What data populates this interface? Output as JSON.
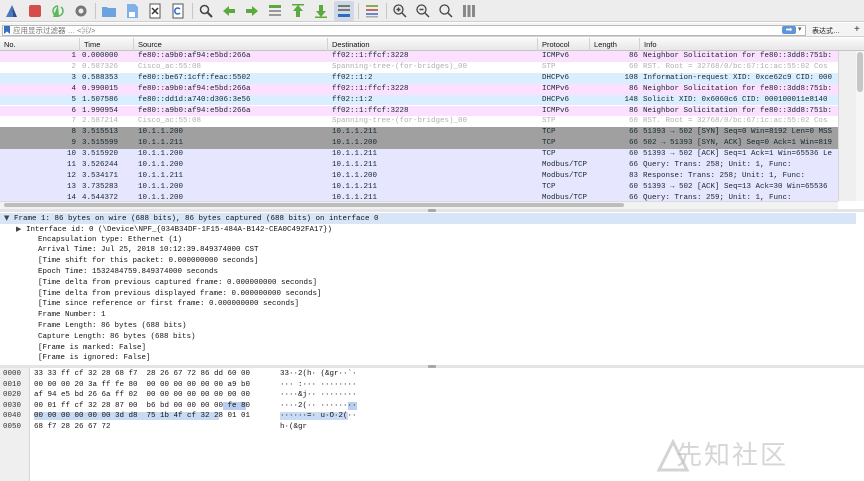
{
  "filter": {
    "placeholder": "应用显示过滤器 … <⌘/>",
    "apply_glyph": "➡",
    "dropdown_glyph": "▾",
    "expression_label": "表达式…",
    "add_glyph": "+"
  },
  "toolbar": {
    "icons": [
      "shark-fin-icon",
      "stop-icon",
      "restart-icon",
      "options-gear-icon",
      "open-folder-icon",
      "save-file-icon",
      "close-file-icon",
      "reload-icon",
      "find-icon",
      "back-arrow-icon",
      "forward-arrow-icon",
      "goto-packet-icon",
      "first-packet-icon",
      "last-packet-icon",
      "autoscroll-icon",
      "colorize-icon",
      "zoom-in-icon",
      "zoom-out-icon",
      "normal-size-icon",
      "resize-columns-icon"
    ]
  },
  "packet_list": {
    "columns": [
      "No.",
      "Time",
      "Source",
      "Destination",
      "Protocol",
      "Length",
      "Info"
    ],
    "rows": [
      {
        "no": "1",
        "time": "0.000000",
        "src": "fe80::a9b0:af94:e5bd:266a",
        "dst": "ff02::1:ffcf:3228",
        "proto": "ICMPv6",
        "len": "86",
        "info": "Neighbor Solicitation for fe80::3dd8:751b:",
        "bg": "#fce0ff",
        "fg": "#12272e"
      },
      {
        "no": "2",
        "time": "0.587326",
        "src": "Cisco_ac:55:08",
        "dst": "Spanning-tree-(for-bridges)_00",
        "proto": "STP",
        "len": "60",
        "info": "RST. Root = 32768/0/bc:67:1c:ac:55:02  Cos",
        "bg": "#ffffff",
        "fg": "#b0b0b0"
      },
      {
        "no": "3",
        "time": "0.588353",
        "src": "fe80::be67:1cff:feac:5502",
        "dst": "ff02::1:2",
        "proto": "DHCPv6",
        "len": "108",
        "info": "Information-request XID: 0xce62c9 CID: 000",
        "bg": "#daeeff",
        "fg": "#12272e"
      },
      {
        "no": "4",
        "time": "0.990015",
        "src": "fe80::a9b0:af94:e5bd:266a",
        "dst": "ff02::1:ffcf:3228",
        "proto": "ICMPv6",
        "len": "86",
        "info": "Neighbor Solicitation for fe80::3dd8:751b:",
        "bg": "#fce0ff",
        "fg": "#12272e"
      },
      {
        "no": "5",
        "time": "1.507586",
        "src": "fe80::dd1d:a740:d306:3e56",
        "dst": "ff02::1:2",
        "proto": "DHCPv6",
        "len": "148",
        "info": "Solicit XID: 0x6060c6 CID: 000100011e8140",
        "bg": "#daeeff",
        "fg": "#12272e"
      },
      {
        "no": "6",
        "time": "1.990954",
        "src": "fe80::a9b0:af94:e5bd:266a",
        "dst": "ff02::1:ffcf:3228",
        "proto": "ICMPv6",
        "len": "86",
        "info": "Neighbor Solicitation for fe80::3dd8:751b:",
        "bg": "#fce0ff",
        "fg": "#12272e"
      },
      {
        "no": "7",
        "time": "2.587214",
        "src": "Cisco_ac:55:08",
        "dst": "Spanning-tree-(for-bridges)_00",
        "proto": "STP",
        "len": "60",
        "info": "RST. Root = 32768/0/bc:67:1c:ac:55:02  Cos",
        "bg": "#ffffff",
        "fg": "#b0b0b0"
      },
      {
        "no": "8",
        "time": "3.515513",
        "src": "10.1.1.200",
        "dst": "10.1.1.211",
        "proto": "TCP",
        "len": "66",
        "info": "51393 → 502 [SYN] Seq=0 Win=8192 Len=0 MSS",
        "bg": "#a0a0a0",
        "fg": "#12272e"
      },
      {
        "no": "9",
        "time": "3.515599",
        "src": "10.1.1.211",
        "dst": "10.1.1.200",
        "proto": "TCP",
        "len": "66",
        "info": "502 → 51393 [SYN, ACK] Seq=0 Ack=1 Win=819",
        "bg": "#a0a0a0",
        "fg": "#12272e"
      },
      {
        "no": "10",
        "time": "3.515920",
        "src": "10.1.1.200",
        "dst": "10.1.1.211",
        "proto": "TCP",
        "len": "60",
        "info": "51393 → 502 [ACK] Seq=1 Ack=1 Win=65536 Le",
        "bg": "#e7e6ff",
        "fg": "#12272e"
      },
      {
        "no": "11",
        "time": "3.526244",
        "src": "10.1.1.200",
        "dst": "10.1.1.211",
        "proto": "Modbus/TCP",
        "len": "66",
        "info": "   Query: Trans:   258; Unit:   1, Func:",
        "bg": "#e7e6ff",
        "fg": "#12272e"
      },
      {
        "no": "12",
        "time": "3.534171",
        "src": "10.1.1.211",
        "dst": "10.1.1.200",
        "proto": "Modbus/TCP",
        "len": "83",
        "info": "Response: Trans:   258; Unit:   1, Func:",
        "bg": "#e7e6ff",
        "fg": "#12272e"
      },
      {
        "no": "13",
        "time": "3.735283",
        "src": "10.1.1.200",
        "dst": "10.1.1.211",
        "proto": "TCP",
        "len": "60",
        "info": "51393 → 502 [ACK] Seq=13 Ack=30 Win=65536",
        "bg": "#e7e6ff",
        "fg": "#12272e"
      },
      {
        "no": "14",
        "time": "4.544372",
        "src": "10.1.1.200",
        "dst": "10.1.1.211",
        "proto": "Modbus/TCP",
        "len": "66",
        "info": "   Query: Trans:   259; Unit:   1, Func:",
        "bg": "#e7e6ff",
        "fg": "#12272e"
      }
    ]
  },
  "details": {
    "lines": [
      {
        "arrow": "▼",
        "indent": 0,
        "text": "Frame 1: 86 bytes on wire (688 bits), 86 bytes captured (688 bits) on interface 0",
        "selected": true
      },
      {
        "arrow": "▶",
        "indent": 1,
        "text": "Interface id: 0 (\\Device\\NPF_{034B34DF-1F15-484A-B142-CEA0C492FA17})",
        "selected": false
      },
      {
        "arrow": "",
        "indent": 2,
        "text": "Encapsulation type: Ethernet (1)",
        "selected": false
      },
      {
        "arrow": "",
        "indent": 2,
        "text": "Arrival Time: Jul 25, 2018 10:12:39.849374000 CST",
        "selected": false
      },
      {
        "arrow": "",
        "indent": 2,
        "text": "[Time shift for this packet: 0.000000000 seconds]",
        "selected": false
      },
      {
        "arrow": "",
        "indent": 2,
        "text": "Epoch Time: 1532484759.849374000 seconds",
        "selected": false
      },
      {
        "arrow": "",
        "indent": 2,
        "text": "[Time delta from previous captured frame: 0.000000000 seconds]",
        "selected": false
      },
      {
        "arrow": "",
        "indent": 2,
        "text": "[Time delta from previous displayed frame: 0.000000000 seconds]",
        "selected": false
      },
      {
        "arrow": "",
        "indent": 2,
        "text": "[Time since reference or first frame: 0.000000000 seconds]",
        "selected": false
      },
      {
        "arrow": "",
        "indent": 2,
        "text": "Frame Number: 1",
        "selected": false
      },
      {
        "arrow": "",
        "indent": 2,
        "text": "Frame Length: 86 bytes (688 bits)",
        "selected": false
      },
      {
        "arrow": "",
        "indent": 2,
        "text": "Capture Length: 86 bytes (688 bits)",
        "selected": false
      },
      {
        "arrow": "",
        "indent": 2,
        "text": "[Frame is marked: False]",
        "selected": false
      },
      {
        "arrow": "",
        "indent": 2,
        "text": "[Frame is ignored: False]",
        "selected": false
      }
    ]
  },
  "hex": {
    "rows": [
      {
        "off": "0000",
        "bytes": "33 33 ff cf 32 28 68 f7  28 26 67 72 86 dd 60 00",
        "ascii": "33··2(h· (&gr··`·"
      },
      {
        "off": "0010",
        "bytes": "00 00 00 20 3a ff fe 80  00 00 00 00 00 00 a9 b0",
        "ascii": "··· :··· ········"
      },
      {
        "off": "0020",
        "bytes": "af 94 e5 bd 26 6a ff 02  00 00 00 00 00 00 00 00",
        "ascii": "····&j·· ········"
      },
      {
        "off": "0030",
        "bytes": "00 01 ff cf 32 28 87 00  b6 bd 00 00 00 00 fe 80",
        "ascii": "····2(·· ········"
      },
      {
        "off": "0040",
        "bytes": "00 00 00 00 00 00 3d d8  75 1b 4f cf 32 28 01 01",
        "ascii": "······=· u·O·2(··"
      },
      {
        "off": "0050",
        "bytes": "68 f7 28 26 67 72",
        "ascii": "h·(&gr"
      }
    ]
  },
  "watermark": {
    "text": "先知社区"
  },
  "colors": {
    "icmpv6_bg": "#fce0ff",
    "dhcpv6_bg": "#daeeff",
    "tcp_syn_bg": "#a0a0a0",
    "tcp_bg": "#e7e6ff",
    "selection_bg": "#d7e5f7",
    "hex_highlight": "#c8dbf3"
  }
}
